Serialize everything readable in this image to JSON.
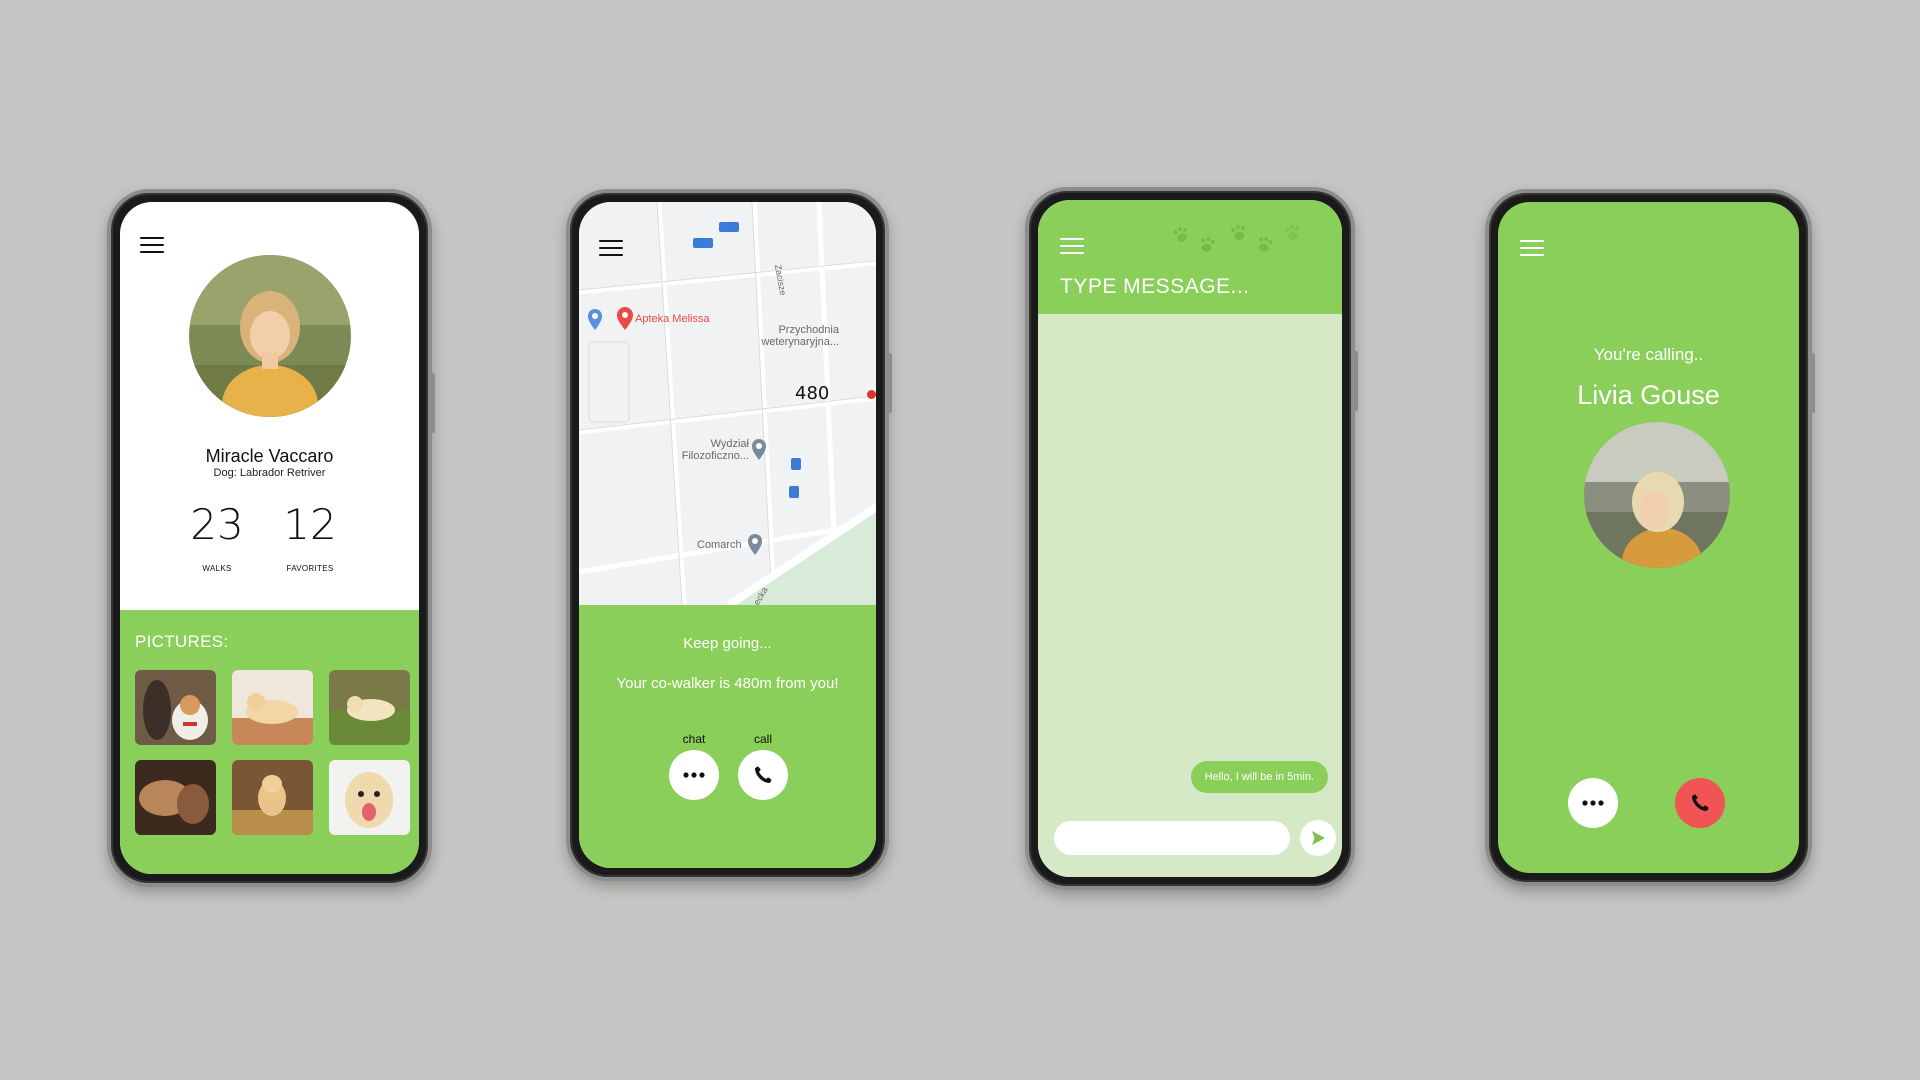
{
  "profile_screen": {
    "name": "Miracle Vaccaro",
    "dog": "Dog: Labrador Retriver",
    "stats": [
      {
        "value": "23",
        "label": "WALKS"
      },
      {
        "value": "12",
        "label": "FAVORITES"
      }
    ],
    "pictures_title": "PICTURES:"
  },
  "map_screen": {
    "map_labels": {
      "pharmacy": "Apteka Melissa",
      "vet_line1": "Przychodnia",
      "vet_line2": "weterynaryjna...",
      "faculty_line1": "Wydział",
      "faculty_line2": "Filozoficzno...",
      "company": "Comarch",
      "street1": "Zacisze",
      "street2": "ecka",
      "distance_marker": "480"
    },
    "status": "Keep going...",
    "distance_text": "Your co-walker is 480m from you!",
    "chat_label": "chat",
    "call_label": "call"
  },
  "chat_screen": {
    "title": "TYPE MESSAGE...",
    "messages": [
      {
        "text": "Hello, I will be in 5min."
      }
    ],
    "input_value": ""
  },
  "call_screen": {
    "status": "You're calling..",
    "callee": "Livia Gouse"
  },
  "colors": {
    "background": "#c5c6c3",
    "accent_green": "#8acf5a",
    "chat_body": "#d5e9c6",
    "end_call_red": "#f05454"
  },
  "icons": [
    "menu-icon",
    "dots-icon",
    "phone-icon",
    "send-icon",
    "paw-icon",
    "location-pin-icon",
    "bus-stop-icon"
  ]
}
